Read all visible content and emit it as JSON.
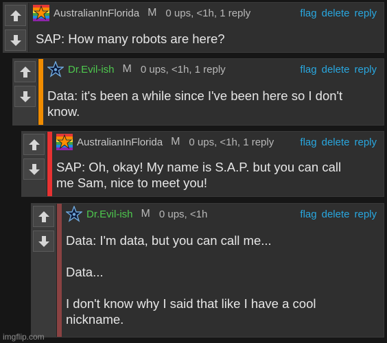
{
  "colors": {
    "username_light": "#c6c6c6",
    "username_green": "#4ec94e",
    "link": "#29a7df",
    "accent_orange": "#f08c00",
    "accent_red": "#e83232",
    "accent_brown": "#8a4242"
  },
  "comments": [
    {
      "username": "AustralianInFlorida",
      "mark": "M",
      "meta": "0 ups, <1h, 1 reply",
      "actions": [
        "flag",
        "delete",
        "reply"
      ],
      "text": "SAP: How many robots are here?",
      "avatar": "rainbow-star-avatar"
    },
    {
      "username": "Dr.Evil-ish",
      "mark": "M",
      "meta": "0 ups, <1h, 1 reply",
      "actions": [
        "flag",
        "delete",
        "reply"
      ],
      "text": "Data: it's been a while since I've been here so I don't\nknow.",
      "avatar": "blue-star-avatar"
    },
    {
      "username": "AustralianInFlorida",
      "mark": "M",
      "meta": "0 ups, <1h, 1 reply",
      "actions": [
        "flag",
        "delete",
        "reply"
      ],
      "text": "SAP: Oh, okay! My name is S.A.P. but you can call\nme Sam, nice to meet you!",
      "avatar": "rainbow-star-avatar"
    },
    {
      "username": "Dr.Evil-ish",
      "mark": "M",
      "meta": "0 ups, <1h",
      "actions": [
        "flag",
        "delete",
        "reply"
      ],
      "text": "Data: I'm data, but you can call me...\n\nData...\n\nI don't know why I said that like I have a cool\nnickname.",
      "avatar": "blue-star-avatar"
    }
  ],
  "watermark": "imgflip.com"
}
